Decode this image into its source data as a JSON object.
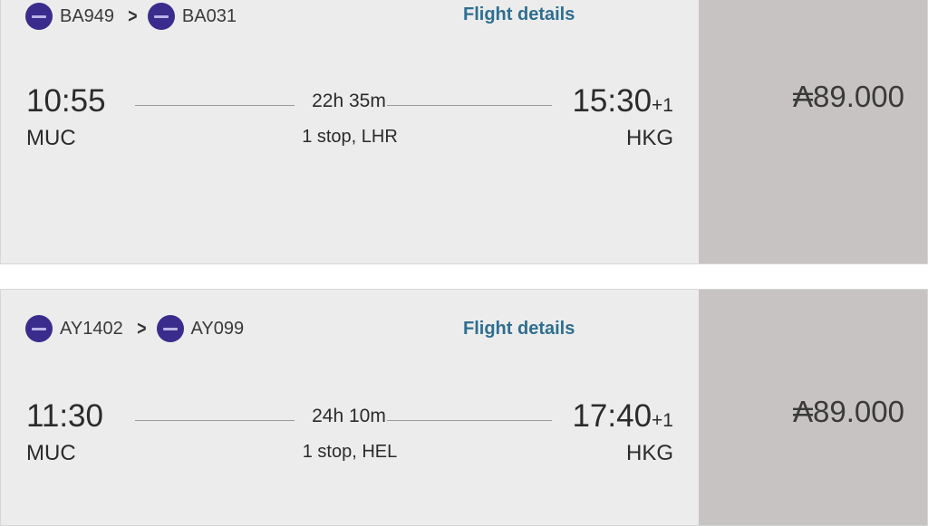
{
  "results": [
    {
      "flights": [
        {
          "number": "BA949",
          "logo_icon": "airline-logo-icon"
        },
        {
          "number": "BA031",
          "logo_icon": "airline-logo-icon"
        }
      ],
      "details_label": "Flight details",
      "departure": {
        "time": "10:55",
        "airport": "MUC"
      },
      "arrival": {
        "time": "15:30",
        "day_offset": "+1",
        "airport": "HKG"
      },
      "duration": "22h 35m",
      "stops": "1 stop, LHR",
      "price": "₳89.000"
    },
    {
      "flights": [
        {
          "number": "AY1402",
          "logo_icon": "airline-logo-icon"
        },
        {
          "number": "AY099",
          "logo_icon": "airline-logo-icon"
        }
      ],
      "details_label": "Flight details",
      "departure": {
        "time": "11:30",
        "airport": "MUC"
      },
      "arrival": {
        "time": "17:40",
        "day_offset": "+1",
        "airport": "HKG"
      },
      "duration": "24h 10m",
      "stops": "1 stop, HEL",
      "price": "₳89.000"
    }
  ],
  "colors": {
    "card_bg": "#ececec",
    "price_bg": "#c8c3c3",
    "link": "#2f6e91",
    "airline_logo": "#3a2c8c"
  }
}
